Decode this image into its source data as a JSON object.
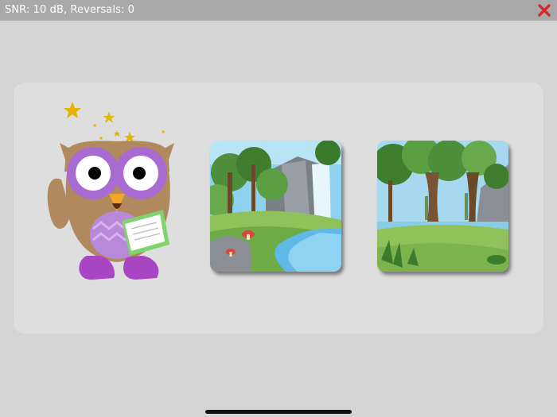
{
  "status": {
    "text": "SNR: 10 dB, Reversals: 0"
  },
  "colors": {
    "topbar": "#a9a9a9",
    "background": "#d4d4d4",
    "panel": "#dedede",
    "close_icon": "#d62b2b"
  },
  "icons": {
    "close": "close-icon",
    "mascot": "owl-reading-book-illustration"
  },
  "choices": [
    {
      "name": "waterfall-river-scene"
    },
    {
      "name": "forest-trees-scene"
    }
  ]
}
